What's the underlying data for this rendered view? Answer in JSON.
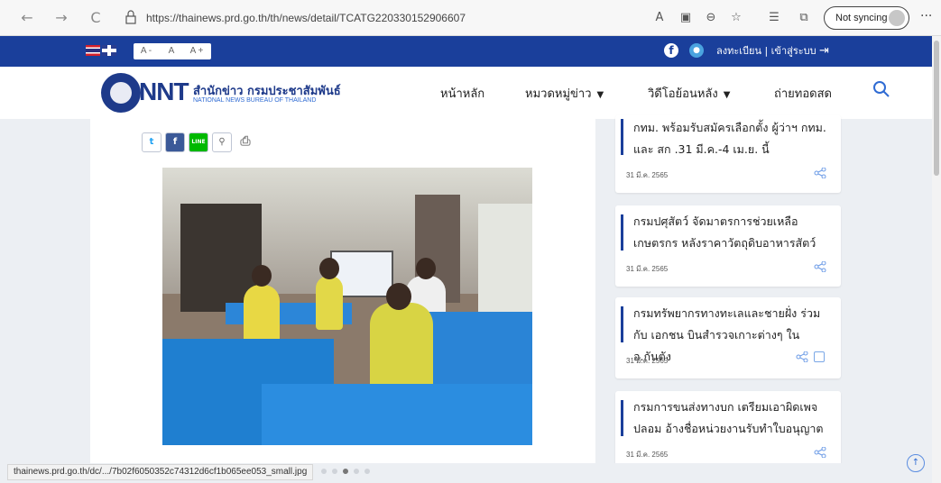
{
  "browser": {
    "back_icon": "back-arrow-icon",
    "forward_icon": "forward-arrow-icon",
    "reload_glyph": "C",
    "url": "https://thainews.prd.go.th/th/news/detail/TCATG220330152906607",
    "sync_label": "Not syncing",
    "more_glyph": "···"
  },
  "topbar": {
    "font_small": "A -",
    "font_normal": "A",
    "font_large": "A +",
    "register_login": "ลงทะเบียน  |  เข้าสู่ระบบ",
    "color": "#1a3f9b"
  },
  "header": {
    "logo_nnt": "NNT",
    "logo_thai": "สำนักข่าว กรมประชาสัมพันธ์",
    "logo_english": "NATIONAL NEWS BUREAU OF THAILAND",
    "menu": [
      {
        "label": "หน้าหลัก"
      },
      {
        "label": "หมวดหมู่ข่าว"
      },
      {
        "label": "วิดีโอย้อนหลัง"
      },
      {
        "label": "ถ่ายทอดสด"
      }
    ]
  },
  "share": {
    "twitter": "t",
    "facebook": "f",
    "line": "LINE"
  },
  "sidebar_news": [
    {
      "title": "กทม. พร้อมรับสมัครเลือกตั้ง ผู้ว่าฯ กทม. และ สก .31 มี.ค.-4 เม.ย. นี้",
      "date": "31 มี.ค. 2565"
    },
    {
      "title": "กรมปศุสัตว์ จัดมาตรการช่วยเหลือ เกษตรกร หลังราคาวัตถุดิบอาหารสัตว์",
      "date": "31 มี.ค. 2565"
    },
    {
      "title": "กรมทรัพยากรทางทะเลและชายฝั่ง ร่วมกับ เอกชน บินสำรวจเกาะต่างๆ ใน อ.กันตัง",
      "date": "31 มี.ค. 2565"
    },
    {
      "title": "กรมการขนส่งทางบก เตรียมเอาผิดเพจ ปลอม อ้างชื่อหน่วยงานรับทำใบอนุญาต",
      "date": "31 มี.ค. 2565"
    }
  ],
  "status_bar": {
    "link": "thainews.prd.go.th/dc/.../7b02f6050352c74312d6cf1b065ee053_small.jpg"
  },
  "carousel": {
    "total": 5,
    "active": 3
  }
}
